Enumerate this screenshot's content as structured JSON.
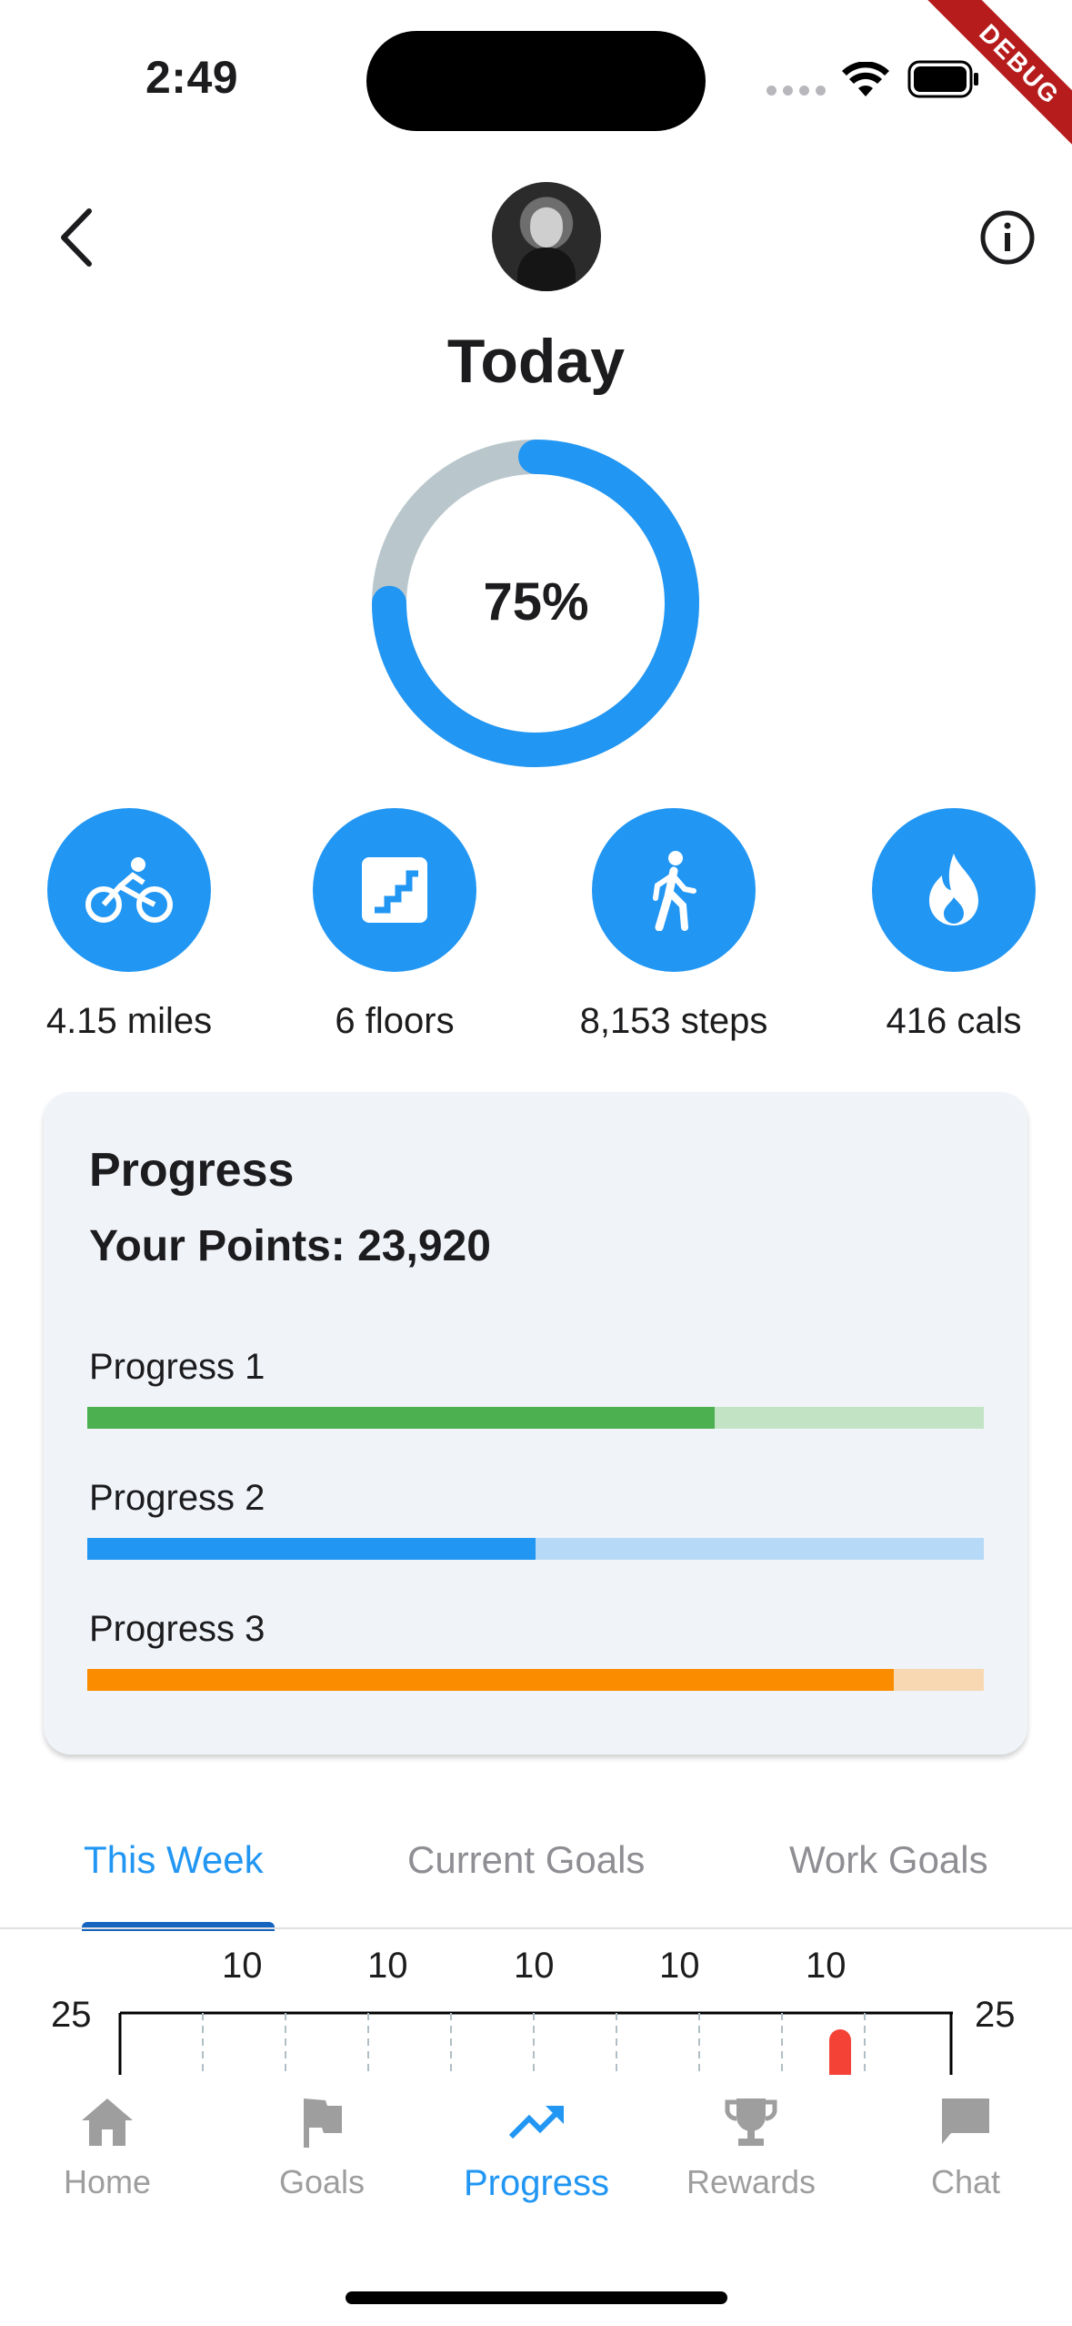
{
  "status_bar": {
    "time": "2:49",
    "debug_banner": "DEBUG"
  },
  "header": {
    "back_icon": "chevron-left-icon",
    "info_icon": "info-circle-icon",
    "title": "Today"
  },
  "daily_ring": {
    "percent_label": "75%",
    "progress": 0.75,
    "color": "#2196f3",
    "track_color": "#b9c7cc"
  },
  "stats": [
    {
      "icon": "bicycle-icon",
      "label": "4.15 miles"
    },
    {
      "icon": "stairs-icon",
      "label": "6 floors"
    },
    {
      "icon": "walking-icon",
      "label": "8,153 steps"
    },
    {
      "icon": "flame-icon",
      "label": "416 cals"
    }
  ],
  "progress_card": {
    "title": "Progress",
    "points": "Your Points: 23,920",
    "bars": [
      {
        "label": "Progress 1",
        "value": 0.7,
        "color": "#4caf50",
        "track": "#c3e3c5"
      },
      {
        "label": "Progress 2",
        "value": 0.5,
        "color": "#2196f3",
        "track": "#b5d9f7"
      },
      {
        "label": "Progress 3",
        "value": 0.9,
        "color": "#fb8c00",
        "track": "#f7d8b3"
      }
    ]
  },
  "tabs": [
    {
      "label": "This Week",
      "active": true
    },
    {
      "label": "Current Goals",
      "active": false
    },
    {
      "label": "Work Goals",
      "active": false
    }
  ],
  "week_chart": {
    "top_labels": [
      "10",
      "10",
      "10",
      "10",
      "10"
    ],
    "left_value": "25",
    "right_value": "25",
    "marker_color": "#f44336"
  },
  "bottom_nav": [
    {
      "label": "Home",
      "icon": "home-icon",
      "active": false
    },
    {
      "label": "Goals",
      "icon": "flag-icon",
      "active": false
    },
    {
      "label": "Progress",
      "icon": "trending-up-icon",
      "active": true
    },
    {
      "label": "Rewards",
      "icon": "trophy-icon",
      "active": false
    },
    {
      "label": "Chat",
      "icon": "chat-icon",
      "active": false
    }
  ]
}
